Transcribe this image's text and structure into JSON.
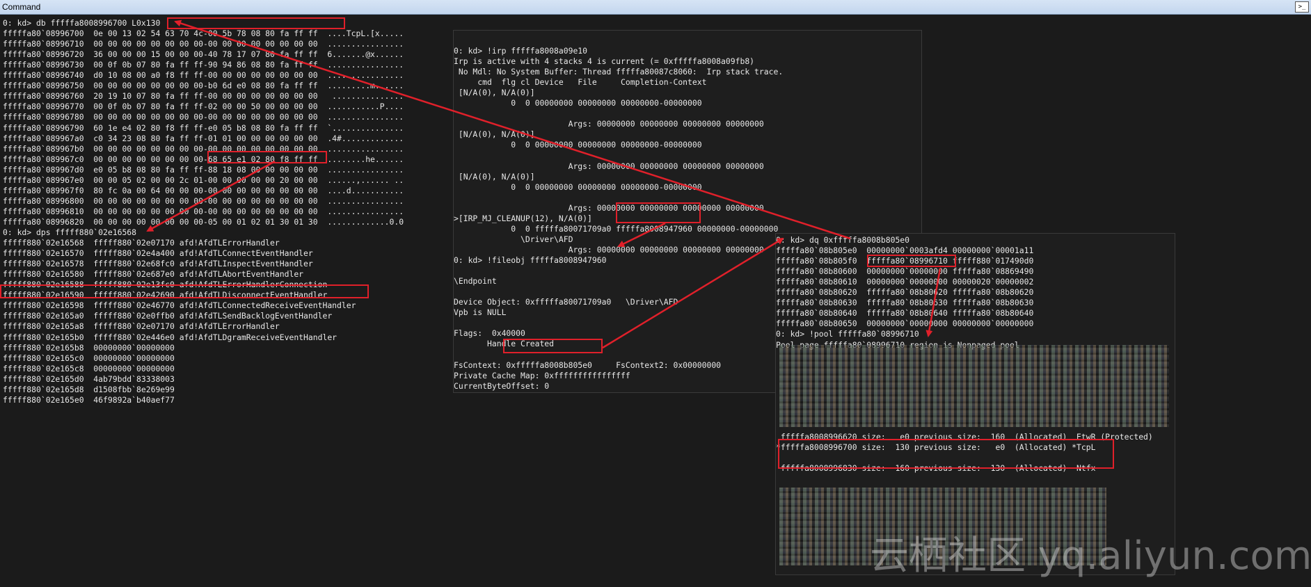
{
  "window": {
    "title": "Command",
    "button_label": ">_"
  },
  "left_pane": {
    "lines": [
      "0: kd> db fffffa8008996700 L0x130",
      "fffffa80`08996700  0e 00 13 02 54 63 70 4c-00 5b 78 08 80 fa ff ff  ....TcpL.[x.....",
      "fffffa80`08996710  00 00 00 00 00 00 00 00-00 00 00 00 00 00 00 00  ................",
      "fffffa80`08996720  36 00 00 00 15 00 00 00-40 78 17 07 80 fa ff ff  6.......@x......",
      "fffffa80`08996730  00 0f 0b 07 80 fa ff ff-90 94 86 08 80 fa ff ff  ................",
      "fffffa80`08996740  d0 10 08 00 a0 f8 ff ff-00 00 00 00 00 00 00 00  ................",
      "fffffa80`08996750  00 00 00 00 00 00 00 00-b0 6d e0 08 80 fa ff ff  .........m......",
      "fffffa80`08996760  20 19 10 07 80 fa ff ff-00 00 00 00 00 00 00 00   ...............",
      "fffffa80`08996770  00 0f 0b 07 80 fa ff ff-02 00 00 50 00 00 00 00  ...........P....",
      "fffffa80`08996780  00 00 00 00 00 00 00 00-00 00 00 00 00 00 00 00  ................",
      "fffffa80`08996790  60 1e e4 02 80 f8 ff ff-e0 05 b8 08 80 fa ff ff  `...............",
      "fffffa80`089967a0  c0 34 23 08 80 fa ff ff-01 01 00 00 00 00 00 00  .4#.............",
      "fffffa80`089967b0  00 00 00 00 00 00 00 00-00 00 00 00 00 00 00 00  ................",
      "fffffa80`089967c0  00 00 00 00 00 00 00 00-68 65 e1 02 80 f8 ff ff  ........he......",
      "fffffa80`089967d0  e0 05 b8 08 80 fa ff ff-88 18 08 00 00 00 00 00  ................",
      "fffffa80`089967e0  00 00 05 02 00 00 2c 01-00 00 00 00 00 20 00 00  ......,...... ..",
      "fffffa80`089967f0  80 fc 0a 00 64 00 00 00-00 00 00 00 00 00 00 00  ....d...........",
      "fffffa80`08996800  00 00 00 00 00 00 00 00-00 00 00 00 00 00 00 00  ................",
      "fffffa80`08996810  00 00 00 00 00 00 00 00-00 00 00 00 00 00 00 00  ................",
      "fffffa80`08996820  00 00 00 00 00 00 00 00-05 00 01 02 01 30 01 30  .............0.0",
      "0: kd> dps fffff880`02e16568",
      "fffff880`02e16568  fffff880`02e07170 afd!AfdTLErrorHandler",
      "fffff880`02e16570  fffff880`02e4a400 afd!AfdTLConnectEventHandler",
      "fffff880`02e16578  fffff880`02e68fc0 afd!AfdTLInspectEventHandler",
      "fffff880`02e16580  fffff880`02e687e0 afd!AfdTLAbortEventHandler",
      "fffff880`02e16588  fffff880`02e13fc0 afd!AfdTLErrorHandlerConnection",
      "fffff880`02e16590  fffff880`02e42690 afd!AfdTLDisconnectEventHandler",
      "fffff880`02e16598  fffff880`02e46770 afd!AfdTLConnectedReceiveEventHandler",
      "fffff880`02e165a0  fffff880`02e0ffb0 afd!AfdTLSendBacklogEventHandler",
      "fffff880`02e165a8  fffff880`02e07170 afd!AfdTLErrorHandler",
      "fffff880`02e165b0  fffff880`02e446e0 afd!AfdTLDgramReceiveEventHandler",
      "fffff880`02e165b8  00000000`00000000",
      "fffff880`02e165c0  00000000`00000000",
      "fffff880`02e165c8  00000000`00000000",
      "fffff880`02e165d0  4ab79bdd`83338003",
      "fffff880`02e165d8  d1508fbb`8e269e99",
      "fffff880`02e165e0  46f9892a`b40aef77"
    ]
  },
  "irp_pane": {
    "lines": [
      "0: kd> !irp fffffa8008a09e10",
      "Irp is active with 4 stacks 4 is current (= 0xfffffa8008a09fb8)",
      " No Mdl: No System Buffer: Thread fffffa80087c8060:  Irp stack trace.",
      "     cmd  flg cl Device   File     Completion-Context",
      " [N/A(0), N/A(0)]",
      "            0  0 00000000 00000000 00000000-00000000",
      "",
      "                        Args: 00000000 00000000 00000000 00000000",
      " [N/A(0), N/A(0)]",
      "            0  0 00000000 00000000 00000000-00000000",
      "",
      "                        Args: 00000000 00000000 00000000 00000000",
      " [N/A(0), N/A(0)]",
      "            0  0 00000000 00000000 00000000-00000000",
      "",
      "                        Args: 00000000 00000000 00000000 00000000",
      ">[IRP_MJ_CLEANUP(12), N/A(0)]",
      "            0  0 fffffa80071709a0 fffffa8008947960 00000000-00000000",
      "              \\Driver\\AFD",
      "                        Args: 00000000 00000000 00000000 00000000",
      "0: kd> !fileobj fffffa8008947960",
      "",
      "\\Endpoint",
      "",
      "Device Object: 0xfffffa80071709a0   \\Driver\\AFD",
      "Vpb is NULL",
      "",
      "Flags:  0x40000",
      "       Handle Created",
      "",
      "FsContext: 0xfffffa8008b805e0     FsContext2: 0x00000000",
      "Private Cache Map: 0xffffffffffffffff",
      "CurrentByteOffset: 0"
    ]
  },
  "dq_pane": {
    "lines": [
      "0: kd> dq 0xfffffa8008b805e0",
      "fffffa80`08b805e0  00000000`0003afd4 00000000`00001a11",
      "fffffa80`08b805f0  fffffa80`08996710 fffff880`017490d0",
      "fffffa80`08b80600  00000000`00000000 fffffa80`08869490",
      "fffffa80`08b80610  00000000`00000000 00000020`00000002",
      "fffffa80`08b80620  fffffa80`08b80620 fffffa80`08b80620",
      "fffffa80`08b80630  fffffa80`08b80630 fffffa80`08b80630",
      "fffffa80`08b80640  fffffa80`08b80640 fffffa80`08b80640",
      "fffffa80`08b80650  00000000`00000000 00000000`00000000",
      "0: kd> !pool fffffa80`08996710",
      "Pool page fffffa80`08996710 region is Nonpaged pool"
    ],
    "pool_lines": [
      " fffffa8008996620 size:   e0 previous size:  160  (Allocated)  EtwR (Protected)",
      "*fffffa8008996700 size:  130 previous size:   e0  (Allocated) *TcpL",
      "",
      " fffffa8008996830 size:  160 previous size:  130  (Allocated)  Ntfx"
    ]
  },
  "watermark": "云栖社区 yq.aliyun.com",
  "colors": {
    "highlight": "#e0202a",
    "text": "#e8e8e8",
    "background": "#1b1b1b"
  }
}
